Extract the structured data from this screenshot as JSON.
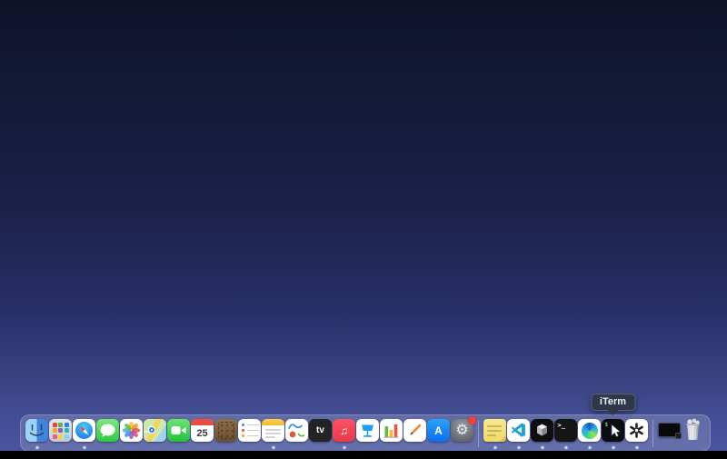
{
  "os": {
    "tooltip": {
      "label": "iTerm"
    }
  },
  "colors": {
    "wallpaper_top": "#0f1329",
    "wallpaper_bottom": "#4c56a0",
    "dock_background": "rgba(128,138,186,0.50)",
    "tooltip_background": "#2f3646",
    "running_dot": "#d7defc",
    "settings_badge": "#fc3d39",
    "bottom_strip": "#000000"
  },
  "dock": {
    "items": [
      {
        "label": "Finder",
        "running": true
      },
      {
        "label": "Launchpad",
        "running": false
      },
      {
        "label": "Safari",
        "running": true
      },
      {
        "label": "Messages",
        "running": false
      },
      {
        "label": "Photos",
        "running": false
      },
      {
        "label": "Maps",
        "running": false
      },
      {
        "label": "FaceTime",
        "running": false
      },
      {
        "label": "Calendar",
        "running": false,
        "day": "25"
      },
      {
        "label": "Contacts",
        "running": false
      },
      {
        "label": "Reminders",
        "running": false
      },
      {
        "label": "Notes",
        "running": true
      },
      {
        "label": "Freeform",
        "running": false
      },
      {
        "label": "TV",
        "running": false,
        "glyph": "tv"
      },
      {
        "label": "Music",
        "running": true,
        "glyph": "♫"
      },
      {
        "label": "Keynote",
        "running": false
      },
      {
        "label": "Numbers",
        "running": false
      },
      {
        "label": "Pages",
        "running": false
      },
      {
        "label": "App Store",
        "running": false,
        "glyph": "A"
      },
      {
        "label": "System Settings",
        "running": false,
        "glyph": "⚙",
        "badge": true
      },
      {
        "label": "Stickies",
        "running": true
      },
      {
        "label": "Visual Studio Code",
        "running": true
      },
      {
        "label": "Unity",
        "running": true
      },
      {
        "label": "Terminal",
        "running": true,
        "glyph": ">_"
      },
      {
        "label": "Microsoft Edge",
        "running": true
      },
      {
        "label": "iTerm",
        "running": true,
        "glyph": "$"
      },
      {
        "label": "ChatGPT",
        "running": true
      },
      {
        "label": "Minimized Terminal Window",
        "running": false
      },
      {
        "label": "Trash",
        "running": false
      }
    ]
  }
}
